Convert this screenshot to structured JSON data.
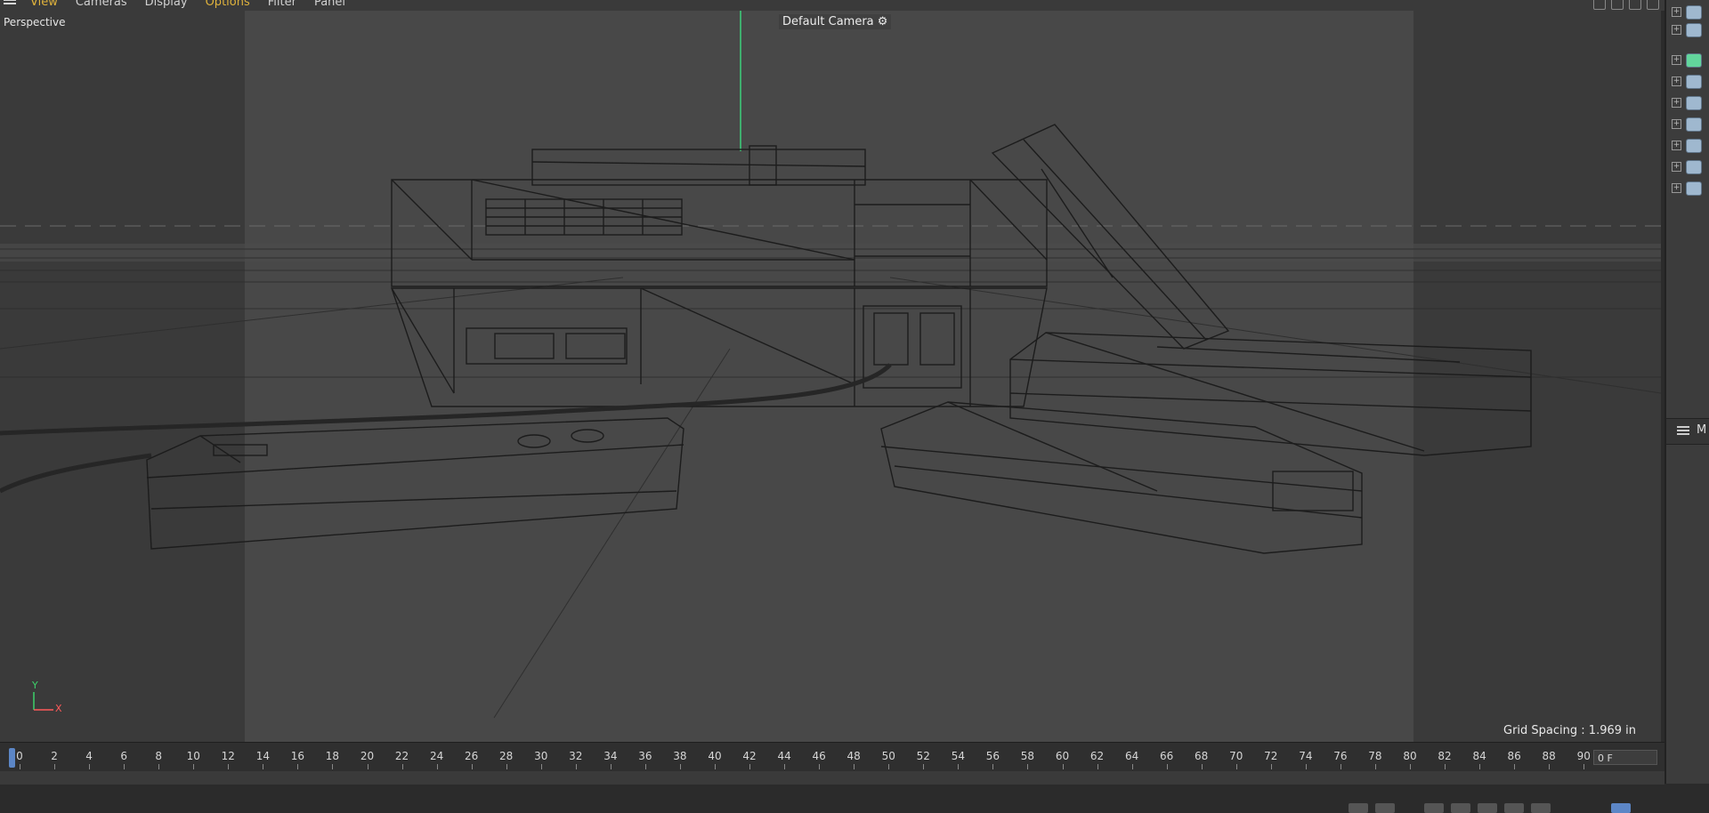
{
  "menu": {
    "items": [
      {
        "label": "View",
        "active": true
      },
      {
        "label": "Cameras",
        "active": false
      },
      {
        "label": "Display",
        "active": false
      },
      {
        "label": "Options",
        "active": true
      },
      {
        "label": "Filter",
        "active": false
      },
      {
        "label": "Panel",
        "active": false
      }
    ],
    "accent_color": "#e0b33c"
  },
  "viewport": {
    "view_name": "Perspective",
    "camera_name": "Default Camera",
    "camera_icon": "camera-settings-icon",
    "grid_spacing_text": "Grid Spacing : 1.969 in",
    "axis_labels": {
      "y": "Y",
      "x": "X"
    }
  },
  "object_manager": {
    "rows": [
      {
        "icon": "null-object-icon",
        "color": "#9fb8cf"
      },
      {
        "icon": "null-object-icon",
        "color": "#9fb8cf"
      },
      {
        "icon": "spline-object-icon",
        "color": "#62d69c"
      },
      {
        "icon": "null-object-icon",
        "color": "#9fb8cf"
      },
      {
        "icon": "null-object-icon",
        "color": "#9fb8cf"
      },
      {
        "icon": "null-object-icon",
        "color": "#9fb8cf"
      },
      {
        "icon": "null-object-icon",
        "color": "#9fb8cf"
      },
      {
        "icon": "null-object-icon",
        "color": "#9fb8cf"
      },
      {
        "icon": "null-object-icon",
        "color": "#9fb8cf"
      }
    ],
    "lower_panel_title": "M"
  },
  "timeline": {
    "ticks": [
      "0",
      "2",
      "4",
      "6",
      "8",
      "10",
      "12",
      "14",
      "16",
      "18",
      "20",
      "22",
      "24",
      "26",
      "28",
      "30",
      "32",
      "34",
      "36",
      "38",
      "40",
      "42",
      "44",
      "46",
      "48",
      "50",
      "52",
      "54",
      "56",
      "58",
      "60",
      "62",
      "64",
      "66",
      "68",
      "70",
      "72",
      "74",
      "76",
      "78",
      "80",
      "82",
      "84",
      "86",
      "88",
      "90"
    ],
    "current_frame": "0 F"
  }
}
